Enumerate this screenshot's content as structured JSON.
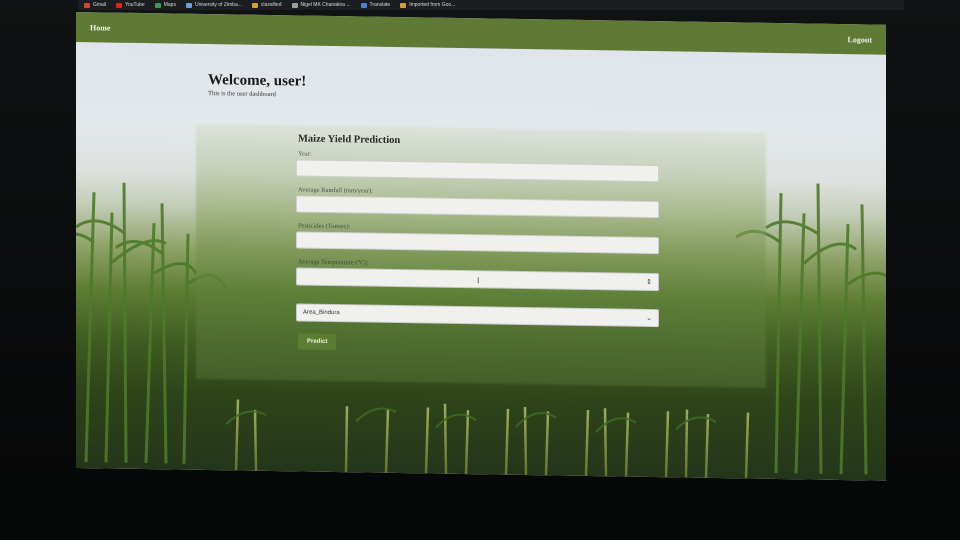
{
  "bookmarks": [
    {
      "label": "Gmail",
      "color": "#d44638"
    },
    {
      "label": "YouTube",
      "color": "#e62117"
    },
    {
      "label": "Maps",
      "color": "#3c9a4c"
    },
    {
      "label": "University of Zimba...",
      "color": "#6aa0d6"
    },
    {
      "label": "classified",
      "color": "#d8a032"
    },
    {
      "label": "Nigel MK Chanakira ...",
      "color": "#9aa0a6"
    },
    {
      "label": "Translate",
      "color": "#4a7fe0"
    },
    {
      "label": "Imported from Goo...",
      "color": "#d8a032"
    }
  ],
  "navbar": {
    "home_label": "Home",
    "logout_label": "Logout",
    "color": "#5e7a35"
  },
  "welcome": {
    "title": "Welcome, user!",
    "subtitle": "This is the user dashboard"
  },
  "form": {
    "title": "Maize Yield Prediction",
    "fields": [
      {
        "label": "Year:",
        "value": ""
      },
      {
        "label": "Average Rainfall (mm/year):",
        "value": ""
      },
      {
        "label": "Pesticides (Tonnes):",
        "value": ""
      },
      {
        "label": "Average Temperature (°C):",
        "value": ""
      }
    ],
    "area_select": {
      "value": "Area_Bindura"
    },
    "predict_label": "Predict",
    "button_color": "#5b7d32"
  }
}
